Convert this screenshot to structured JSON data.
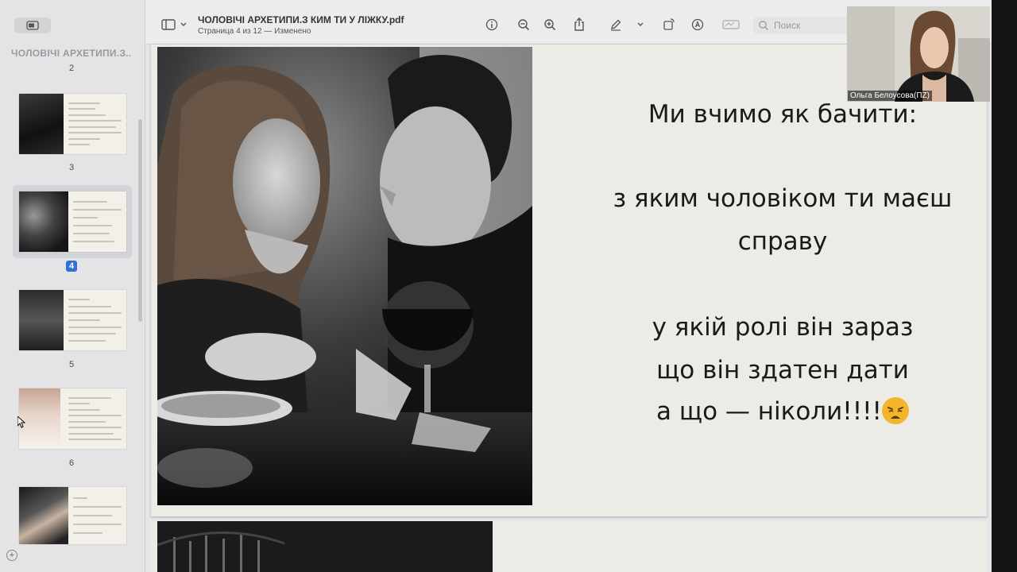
{
  "sidebar": {
    "title": "ЧОЛОВІЧІ АРХЕТИПИ.З...",
    "pages": [
      {
        "label": "2"
      },
      {
        "label": "3"
      },
      {
        "label": "4",
        "selected": true
      },
      {
        "label": "5"
      },
      {
        "label": "6"
      }
    ]
  },
  "toolbar": {
    "doc_title": "ЧОЛОВІЧІ АРХЕТИПИ.З КИМ ТИ У ЛІЖКУ.pdf",
    "doc_subtitle": "Страница 4 из 12 — Изменено",
    "search_placeholder": "Поиск",
    "icons": [
      "sidebar-icon",
      "chevron-down-icon",
      "info-icon",
      "zoom-out-icon",
      "zoom-in-icon",
      "share-icon",
      "markup-pen-icon",
      "chevron-down-icon",
      "rotate-icon",
      "annotate-icon",
      "signature-icon",
      "search-icon"
    ]
  },
  "slide": {
    "line1": "Ми вчимо як бачити:",
    "line2": "з яким чоловіком ти маєш",
    "line3": "справу",
    "line4": "у якій ролі він зараз",
    "line5": "що він здатен дати",
    "line6": "а що — ніколи!!!!",
    "emoji": "weary-face-icon"
  },
  "video": {
    "participant_name": "Ольга Белоусова(ПZ)"
  }
}
